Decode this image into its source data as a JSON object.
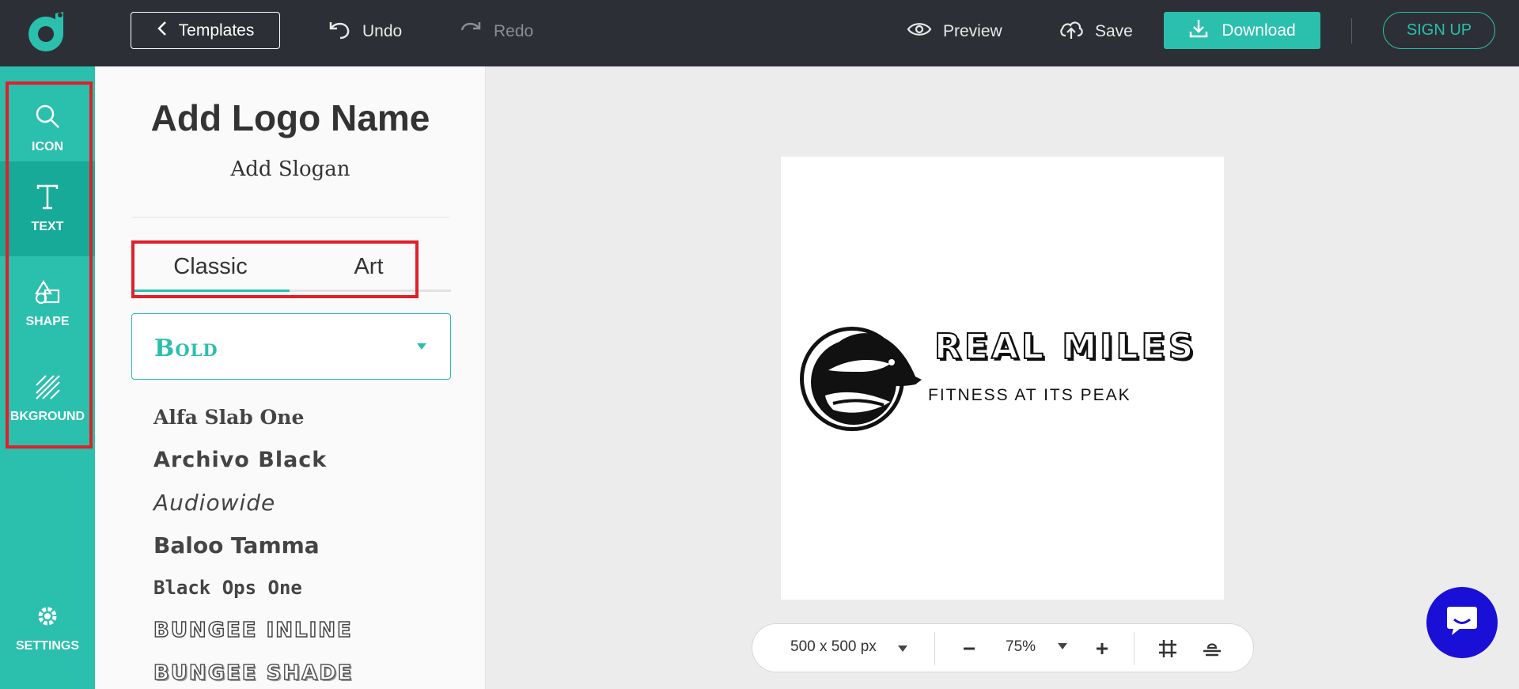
{
  "topbar": {
    "templates_label": "Templates",
    "undo_label": "Undo",
    "redo_label": "Redo",
    "preview_label": "Preview",
    "save_label": "Save",
    "download_label": "Download",
    "signup_label": "SIGN UP"
  },
  "rail": {
    "items": [
      {
        "label": "ICON",
        "icon": "search-icon"
      },
      {
        "label": "TEXT",
        "icon": "text-icon"
      },
      {
        "label": "SHAPE",
        "icon": "shapes-icon"
      },
      {
        "label": "BKGROUND",
        "icon": "background-icon"
      }
    ],
    "settings_label": "SETTINGS",
    "active": "TEXT"
  },
  "panel": {
    "title": "Add Logo Name",
    "slogan": "Add Slogan",
    "tabs": [
      "Classic",
      "Art"
    ],
    "active_tab": "Classic",
    "category": "Bold",
    "fonts": [
      "Alfa Slab One",
      "Archivo Black",
      "Audiowide",
      "Baloo Tamma",
      "Black Ops One",
      "BUNGEE INLINE",
      "BUNGEE SHADE"
    ]
  },
  "canvas": {
    "logo_name": "REAL MILES",
    "logo_slogan": "FITNESS AT ITS PEAK"
  },
  "zoombar": {
    "size": "500 x 500 px",
    "zoom": "75%"
  },
  "colors": {
    "accent": "#2bbfad",
    "topbar": "#2c3036",
    "highlight": "#e0202a",
    "chat": "#1a0fd6"
  }
}
